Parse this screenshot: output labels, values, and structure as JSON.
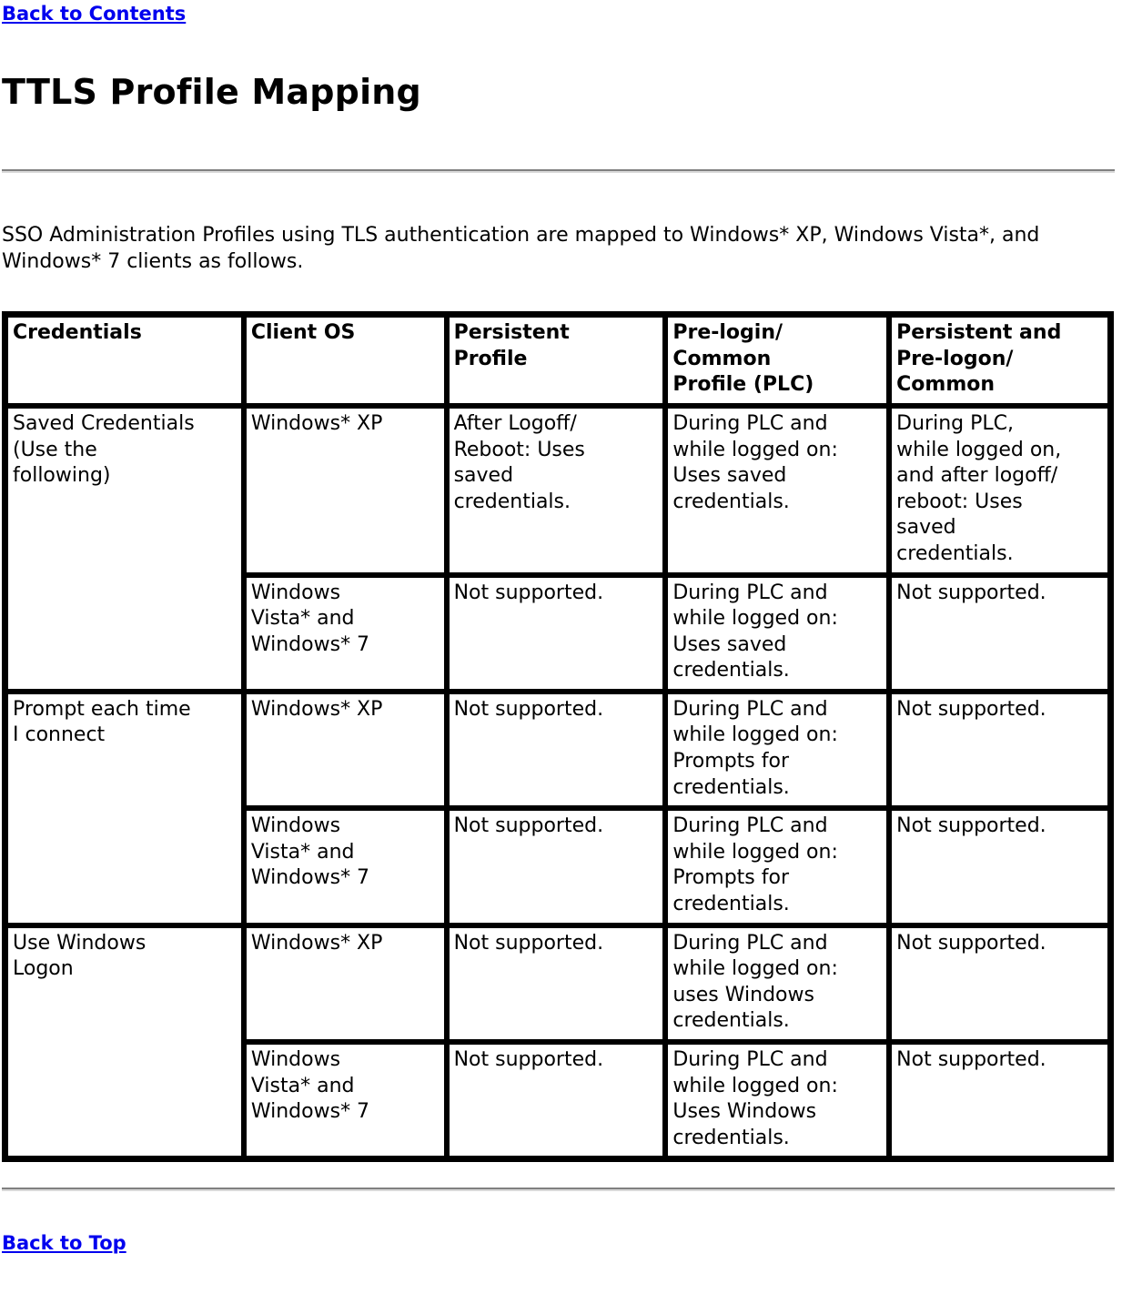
{
  "nav": {
    "back_to_contents": "Back to Contents",
    "back_to_top": "Back to Top"
  },
  "header": {
    "title": "TTLS Profile Mapping"
  },
  "intro": {
    "paragraph": "SSO Administration Profiles using TLS authentication are mapped to Windows* XP, Windows Vista*, and Windows* 7 clients as follows."
  },
  "table": {
    "columns": [
      "Credentials",
      "Client OS",
      "Persistent\nProfile",
      "Pre-login/\nCommon\nProfile (PLC)",
      "Persistent and\nPre-logon/\nCommon"
    ],
    "groups": [
      {
        "credentials": "Saved Credentials\n(Use the\nfollowing)",
        "rows": [
          {
            "client_os": "Windows* XP",
            "persistent_profile": "After Logoff/\nReboot: Uses\nsaved\ncredentials.",
            "plc": "During PLC and\nwhile logged on:\nUses saved\ncredentials.",
            "persistent_prelogon": "During PLC,\nwhile logged on,\nand after logoff/\nreboot: Uses\nsaved\ncredentials."
          },
          {
            "client_os": "Windows\nVista* and\nWindows* 7",
            "persistent_profile": "Not supported.",
            "plc": "During PLC and\nwhile logged on:\nUses saved\ncredentials.",
            "persistent_prelogon": "Not supported."
          }
        ]
      },
      {
        "credentials": "Prompt each time\nI connect",
        "rows": [
          {
            "client_os": "Windows* XP",
            "persistent_profile": "Not supported.",
            "plc": "During PLC and\nwhile logged on:\nPrompts for\ncredentials.",
            "persistent_prelogon": "Not supported."
          },
          {
            "client_os": "Windows\nVista* and\nWindows* 7",
            "persistent_profile": "Not supported.",
            "plc": "During PLC and\nwhile logged on:\nPrompts for\ncredentials.",
            "persistent_prelogon": "Not supported."
          }
        ]
      },
      {
        "credentials": "Use Windows\nLogon",
        "rows": [
          {
            "client_os": "Windows* XP",
            "persistent_profile": "Not supported.",
            "plc": "During PLC and\nwhile logged on:\nuses Windows\ncredentials.",
            "persistent_prelogon": "Not supported."
          },
          {
            "client_os": "Windows\nVista* and\nWindows* 7",
            "persistent_profile": "Not supported.",
            "plc": "During PLC and\nwhile logged on:\nUses Windows\ncredentials.",
            "persistent_prelogon": "Not supported."
          }
        ]
      }
    ]
  },
  "colors": {
    "link": "#0000ee",
    "text": "#000000",
    "rule": "#808080",
    "border": "#000000"
  }
}
